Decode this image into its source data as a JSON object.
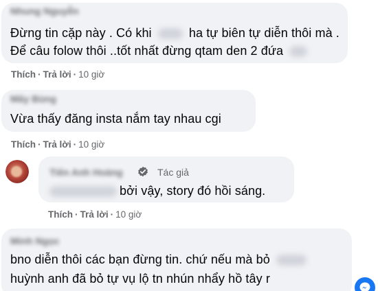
{
  "comments": [
    {
      "author": "Nhung Nguyễn",
      "lines": [
        "Đừng tin cặp này . Có khi",
        "ha tự biên tự diễn thôi mà .",
        "Để câu folow thôi ..tốt nhất đừng qtam den 2 đứa"
      ],
      "actions": {
        "like": "Thích",
        "reply": "Trả lời",
        "time": "10 giờ"
      }
    },
    {
      "author": "Mây Bùng",
      "lines": [
        "Vừa thấy đăng insta nắm tay nhau cgi"
      ],
      "actions": {
        "like": "Thích",
        "reply": "Trả lời",
        "time": "10 giờ"
      }
    },
    {
      "author": "Tiên Anh Hoàng",
      "author_badge": "Tác giả",
      "mention": "Mây Bùng",
      "lines": [
        "bởi vậy, story đó hồi sáng."
      ],
      "actions": {
        "like": "Thích",
        "reply": "Trả lời",
        "time": "10 giờ"
      }
    },
    {
      "author": "Minh Ngọc",
      "lines": [
        "bno diễn thôi các bạn đừng tin. chứ nếu mà bỏ",
        "huỳnh anh đã bỏ tự vụ lộ tn nhún nhẩy hồ tây r"
      ]
    }
  ],
  "separator": "·",
  "colors": {
    "bubble": "#f0f2f5",
    "meta": "#65676b",
    "text": "#050505",
    "verified": "#65676b",
    "fab": "#1877f2"
  },
  "icons": {
    "verified": "verified-check-icon",
    "fab": "messenger-icon"
  }
}
